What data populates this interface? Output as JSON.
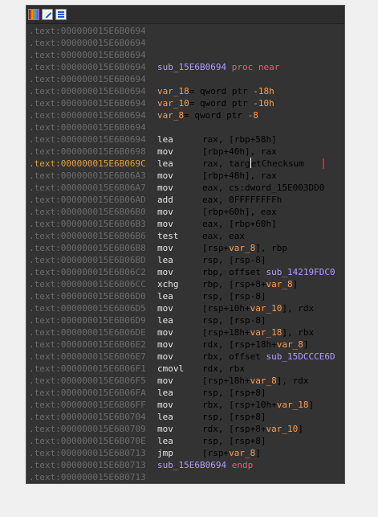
{
  "toolbar": {
    "icons": [
      "colors-icon",
      "edit-icon",
      "graph-view-icon"
    ]
  },
  "lines": [
    {
      "addr": ".text:000000015E6B0694",
      "kind": "blank"
    },
    {
      "addr": ".text:000000015E6B0694",
      "kind": "blank"
    },
    {
      "addr": ".text:000000015E6B0694",
      "kind": "blank"
    },
    {
      "addr": ".text:000000015E6B0694",
      "kind": "text",
      "tokens": [
        {
          "t": "sub_15E6B0694 ",
          "c": "func"
        },
        {
          "t": "proc near",
          "c": "kw"
        }
      ]
    },
    {
      "addr": ".text:000000015E6B0694",
      "kind": "blank"
    },
    {
      "addr": ".text:000000015E6B0694",
      "kind": "text",
      "tokens": [
        {
          "t": "var_18",
          "c": "var"
        },
        {
          "t": "= qword ptr ",
          "c": "plain"
        },
        {
          "t": "-18h",
          "c": "var"
        }
      ]
    },
    {
      "addr": ".text:000000015E6B0694",
      "kind": "text",
      "tokens": [
        {
          "t": "var_10",
          "c": "var"
        },
        {
          "t": "= qword ptr ",
          "c": "plain"
        },
        {
          "t": "-10h",
          "c": "var"
        }
      ]
    },
    {
      "addr": ".text:000000015E6B0694",
      "kind": "text",
      "tokens": [
        {
          "t": "var_8",
          "c": "var"
        },
        {
          "t": "= qword ptr ",
          "c": "plain"
        },
        {
          "t": "-8",
          "c": "var"
        }
      ]
    },
    {
      "addr": ".text:000000015E6B0694",
      "kind": "blank"
    },
    {
      "addr": ".text:000000015E6B0694",
      "kind": "instr",
      "mnemonic": "lea",
      "tokens": [
        {
          "t": "rax, [rbp+58h]",
          "c": "plain"
        }
      ]
    },
    {
      "addr": ".text:000000015E6B0698",
      "kind": "instr",
      "mnemonic": "mov",
      "tokens": [
        {
          "t": "[rbp+40h], rax",
          "c": "plain"
        }
      ]
    },
    {
      "addr": ".text:000000015E6B069C",
      "kind": "instr",
      "mnemonic": "lea",
      "current": true,
      "tokens": [
        {
          "t": "rax, targ",
          "c": "plain"
        },
        {
          "t": "",
          "c": "cursor"
        },
        {
          "t": "etChecksum",
          "c": "plain"
        }
      ]
    },
    {
      "addr": ".text:000000015E6B06A3",
      "kind": "instr",
      "mnemonic": "mov",
      "tokens": [
        {
          "t": "[rbp+48h], rax",
          "c": "plain"
        }
      ]
    },
    {
      "addr": ".text:000000015E6B06A7",
      "kind": "instr",
      "mnemonic": "mov",
      "tokens": [
        {
          "t": "eax, cs:dword_15E003DD0",
          "c": "plain"
        }
      ]
    },
    {
      "addr": ".text:000000015E6B06AD",
      "kind": "instr",
      "mnemonic": "add",
      "tokens": [
        {
          "t": "eax, 0FFFFFFFFh",
          "c": "plain"
        }
      ]
    },
    {
      "addr": ".text:000000015E6B06B0",
      "kind": "instr",
      "mnemonic": "mov",
      "tokens": [
        {
          "t": "[rbp+60h], eax",
          "c": "plain"
        }
      ]
    },
    {
      "addr": ".text:000000015E6B06B3",
      "kind": "instr",
      "mnemonic": "mov",
      "tokens": [
        {
          "t": "eax, [rbp+60h]",
          "c": "plain"
        }
      ]
    },
    {
      "addr": ".text:000000015E6B06B6",
      "kind": "instr",
      "mnemonic": "test",
      "tokens": [
        {
          "t": "eax, eax",
          "c": "plain"
        }
      ]
    },
    {
      "addr": ".text:000000015E6B06B8",
      "kind": "instr",
      "mnemonic": "mov",
      "tokens": [
        {
          "t": "[rsp+",
          "c": "plain"
        },
        {
          "t": "var_8",
          "c": "var"
        },
        {
          "t": "], rbp",
          "c": "plain"
        }
      ]
    },
    {
      "addr": ".text:000000015E6B06BD",
      "kind": "instr",
      "mnemonic": "lea",
      "tokens": [
        {
          "t": "rsp, [rsp-8]",
          "c": "plain"
        }
      ]
    },
    {
      "addr": ".text:000000015E6B06C2",
      "kind": "instr",
      "mnemonic": "mov",
      "tokens": [
        {
          "t": "rbp, offset ",
          "c": "plain"
        },
        {
          "t": "sub_14219FDC0",
          "c": "sym"
        }
      ]
    },
    {
      "addr": ".text:000000015E6B06CC",
      "kind": "instr",
      "mnemonic": "xchg",
      "tokens": [
        {
          "t": "rbp, [rsp+8+",
          "c": "plain"
        },
        {
          "t": "var_8",
          "c": "var"
        },
        {
          "t": "]",
          "c": "plain"
        }
      ]
    },
    {
      "addr": ".text:000000015E6B06D0",
      "kind": "instr",
      "mnemonic": "lea",
      "tokens": [
        {
          "t": "rsp, [rsp-8]",
          "c": "plain"
        }
      ]
    },
    {
      "addr": ".text:000000015E6B06D5",
      "kind": "instr",
      "mnemonic": "mov",
      "tokens": [
        {
          "t": "[rsp+10h+",
          "c": "plain"
        },
        {
          "t": "var_10",
          "c": "var"
        },
        {
          "t": "], rdx",
          "c": "plain"
        }
      ]
    },
    {
      "addr": ".text:000000015E6B06D9",
      "kind": "instr",
      "mnemonic": "lea",
      "tokens": [
        {
          "t": "rsp, [rsp-8]",
          "c": "plain"
        }
      ]
    },
    {
      "addr": ".text:000000015E6B06DE",
      "kind": "instr",
      "mnemonic": "mov",
      "tokens": [
        {
          "t": "[rsp+18h+",
          "c": "plain"
        },
        {
          "t": "var_18",
          "c": "var"
        },
        {
          "t": "], rbx",
          "c": "plain"
        }
      ]
    },
    {
      "addr": ".text:000000015E6B06E2",
      "kind": "instr",
      "mnemonic": "mov",
      "tokens": [
        {
          "t": "rdx, [rsp+18h+",
          "c": "plain"
        },
        {
          "t": "var_8",
          "c": "var"
        },
        {
          "t": "]",
          "c": "plain"
        }
      ]
    },
    {
      "addr": ".text:000000015E6B06E7",
      "kind": "instr",
      "mnemonic": "mov",
      "tokens": [
        {
          "t": "rbx, offset ",
          "c": "plain"
        },
        {
          "t": "sub_15DCCCE6D",
          "c": "sym"
        }
      ]
    },
    {
      "addr": ".text:000000015E6B06F1",
      "kind": "instr",
      "mnemonic": "cmovl",
      "tokens": [
        {
          "t": "rdx, rbx",
          "c": "plain"
        }
      ]
    },
    {
      "addr": ".text:000000015E6B06F5",
      "kind": "instr",
      "mnemonic": "mov",
      "tokens": [
        {
          "t": "[rsp+18h+",
          "c": "plain"
        },
        {
          "t": "var_8",
          "c": "var"
        },
        {
          "t": "], rdx",
          "c": "plain"
        }
      ]
    },
    {
      "addr": ".text:000000015E6B06FA",
      "kind": "instr",
      "mnemonic": "lea",
      "tokens": [
        {
          "t": "rsp, [rsp+8]",
          "c": "plain"
        }
      ]
    },
    {
      "addr": ".text:000000015E6B06FF",
      "kind": "instr",
      "mnemonic": "mov",
      "tokens": [
        {
          "t": "rbx, [rsp+10h+",
          "c": "plain"
        },
        {
          "t": "var_18",
          "c": "var"
        },
        {
          "t": "]",
          "c": "plain"
        }
      ]
    },
    {
      "addr": ".text:000000015E6B0704",
      "kind": "instr",
      "mnemonic": "lea",
      "tokens": [
        {
          "t": "rsp, [rsp+8]",
          "c": "plain"
        }
      ]
    },
    {
      "addr": ".text:000000015E6B0709",
      "kind": "instr",
      "mnemonic": "mov",
      "tokens": [
        {
          "t": "rdx, [rsp+8+",
          "c": "plain"
        },
        {
          "t": "var_10",
          "c": "var"
        },
        {
          "t": "]",
          "c": "plain"
        }
      ]
    },
    {
      "addr": ".text:000000015E6B070E",
      "kind": "instr",
      "mnemonic": "lea",
      "tokens": [
        {
          "t": "rsp, [rsp+8]",
          "c": "plain"
        }
      ]
    },
    {
      "addr": ".text:000000015E6B0713",
      "kind": "instr",
      "mnemonic": "jmp",
      "tokens": [
        {
          "t": "[rsp+",
          "c": "plain"
        },
        {
          "t": "var_8",
          "c": "var"
        },
        {
          "t": "]",
          "c": "plain"
        }
      ]
    },
    {
      "addr": ".text:000000015E6B0713",
      "kind": "text",
      "tokens": [
        {
          "t": "sub_15E6B0694 ",
          "c": "func"
        },
        {
          "t": "endp",
          "c": "kw"
        }
      ]
    },
    {
      "addr": ".text:000000015E6B0713",
      "kind": "blank"
    }
  ],
  "colors": {
    "background": "#333333",
    "address": "#6b6b6b",
    "address_current": "#e0a040",
    "text": "#e6e6e6",
    "variable": "#ff9a4a",
    "symbol": "#b49cff",
    "keyword": "#ff5070",
    "marker": "#e0202a"
  }
}
